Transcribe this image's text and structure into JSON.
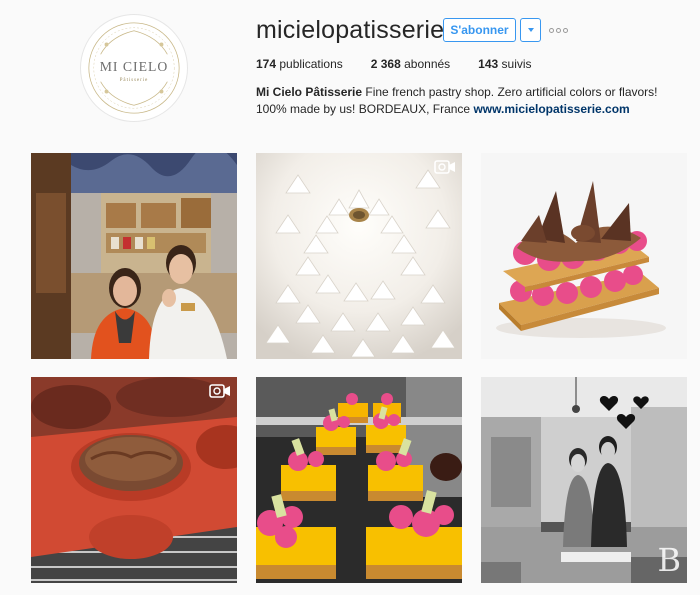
{
  "profile": {
    "username": "micielopatisserie",
    "follow_label": "S'abonner",
    "avatar_logo_text": "MI CIELO",
    "avatar_logo_sub": "Pâtisserie"
  },
  "stats": {
    "posts_count": "174",
    "posts_label": "publications",
    "followers_count": "2 368",
    "followers_label": "abonnés",
    "following_count": "143",
    "following_label": "suivis"
  },
  "bio": {
    "name": "Mi Cielo Pâtisserie",
    "text": "Fine french pastry shop. Zero artificial colors or flavors! 100% made by us! BORDEAUX, France",
    "website": "www.micielopatisserie.com"
  },
  "icons": {
    "more": "more-options-icon",
    "dropdown": "chevron-down-icon",
    "video": "video-camera-icon"
  },
  "colors": {
    "accent": "#3897f0",
    "link": "#003569",
    "pink": "#e84d8a",
    "mango": "#f7c400"
  },
  "posts": [
    {
      "kind": "photo",
      "subject": "couple-in-shop"
    },
    {
      "kind": "video",
      "subject": "piped-meringue"
    },
    {
      "kind": "photo",
      "subject": "mille-feuille"
    },
    {
      "kind": "video",
      "subject": "silicone-mold"
    },
    {
      "kind": "photo",
      "subject": "yellow-tartlets"
    },
    {
      "kind": "photo",
      "subject": "bw-shop-owners"
    }
  ],
  "watermark": "B"
}
